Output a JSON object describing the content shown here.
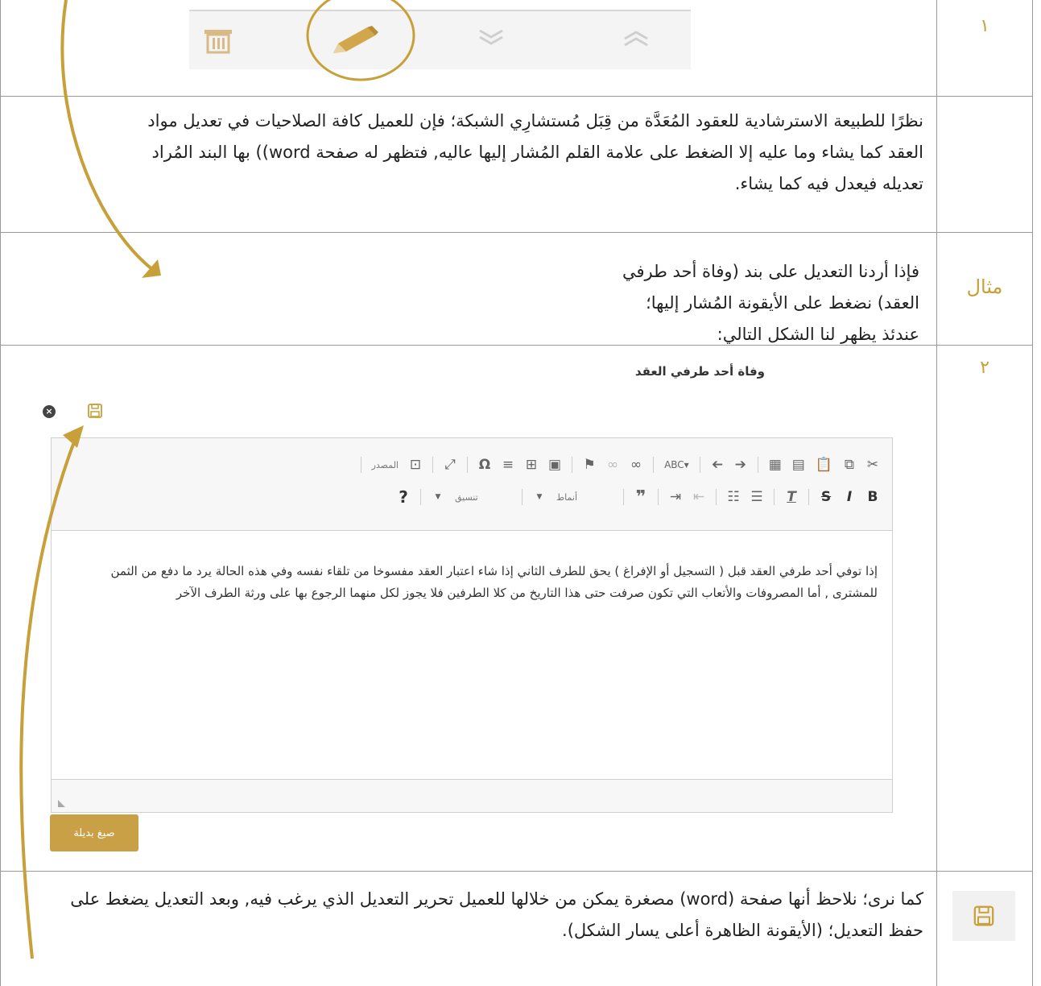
{
  "rows": [
    {
      "label": "١"
    },
    {
      "label": ""
    },
    {
      "label": "مثال"
    },
    {
      "label": "٢"
    },
    {
      "label": ""
    }
  ],
  "row2_text": "نظرًا للطبيعة الاسترشادية للعقود المُعَدَّة من قِبَل مُستشارِي الشبكة؛ فإن للعميل كافة الصلاحيات في تعديل مواد العقد كما يشاء وما عليه إلا الضغط على علامة القلم المُشار إليها عاليه, فتظهر له صفحة word)) بها البند المُراد تعديله فيعدل فيه كما يشاء.",
  "example_text": "فإذا أردنا التعديل على بند (وفاة أحد طرفي العقد) نضغط على الأيقونة المُشار إليها؛ عندئذ يظهر لنا الشكل التالي:",
  "clause_title": "وفاة أحد طرفي العقد",
  "editor": {
    "source_label": "المصدر",
    "styles_label": "أنماط",
    "format_label": "تنسيق",
    "help_label": "?",
    "bold_label": "B",
    "italic_label": "I",
    "strike_label": "S",
    "body_text": "إذا توفي أحد طرفي العقد قبل ( التسجيل أو الإفراغ ) يحق للطرف الثاني إذا شاء اعتبار العقد مفسوخا من تلقاء نفسه وفي هذه الحالة يرد ما دفع من الثمن للمشترى , أما المصروفات والأتعاب التي تكون صرفت حتى هذا التاريخ من كلا الطرفين فلا يجوز لكل منهما الرجوع بها على ورثة الطرف الآخر"
  },
  "submit_label": "صيغ بديلة",
  "last_text": "كما نرى؛ نلاحظ أنها صفحة (word) مصغرة يمكن من خلالها للعميل تحرير التعديل الذي يرغب فيه, وبعد التعديل يضغط على حفظ التعديل؛ (الأيقونة الظاهرة أعلى يسار الشكل).",
  "colors": {
    "accent": "#c8a03a",
    "button": "#c9a045",
    "border": "#9a9a9a"
  }
}
